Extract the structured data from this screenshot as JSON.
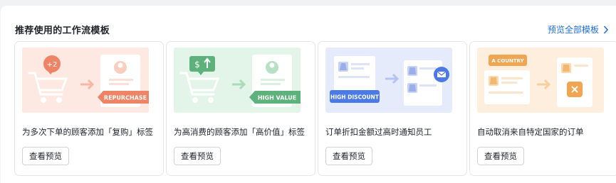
{
  "panel": {
    "title": "推荐使用的工作流模板",
    "see_all_label": "预览全部模板"
  },
  "cards": [
    {
      "title": "为多次下单的顾客添加「复购」标签",
      "button_label": "查看预览",
      "thumb_badge": "+2",
      "thumb_tag": "REPURCHASE",
      "thumb_theme": "#fde8e2"
    },
    {
      "title": "为高消费的顾客添加「高价值」标签",
      "button_label": "查看预览",
      "thumb_badge": "$ ↑",
      "thumb_tag": "HIGH VALUE",
      "thumb_theme": "#e3f4e8"
    },
    {
      "title": "订单折扣金额过高时通知员工",
      "button_label": "查看预览",
      "thumb_tag": "HIGH DISCOUNT",
      "thumb_theme": "#e6ebfb"
    },
    {
      "title": "自动取消来自特定国家的订单",
      "button_label": "查看预览",
      "thumb_tag": "A COUNTRY",
      "thumb_theme": "#fdeedd"
    }
  ],
  "colors": {
    "accent_link": "#1d6fe0",
    "repurchase": "#ee8466",
    "high_value": "#5cb27a",
    "high_discount": "#4b7ae6",
    "country": "#f0a650"
  }
}
